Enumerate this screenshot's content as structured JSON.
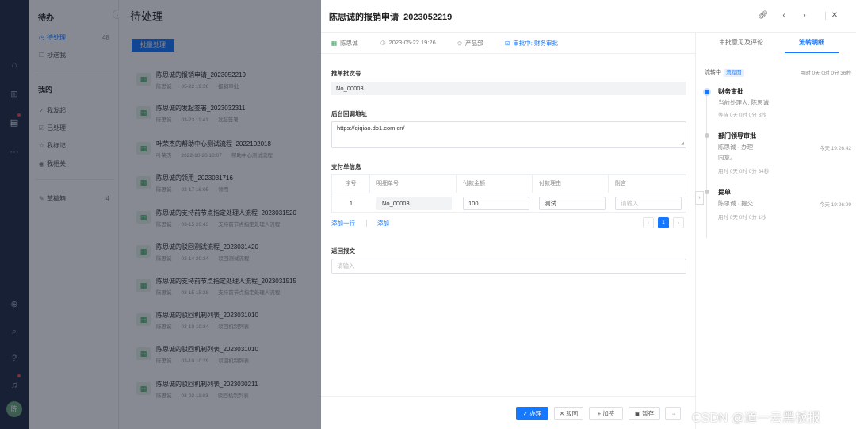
{
  "rail": {
    "icons": [
      "home-icon",
      "apps-icon",
      "doc-icon",
      "more-icon",
      "add-icon",
      "search-icon",
      "help-icon",
      "bell-icon"
    ],
    "avatar": "陈"
  },
  "sidebar": {
    "header": "待办",
    "todo": [
      {
        "label": "待处理",
        "count": "48"
      },
      {
        "label": "抄送我",
        "count": ""
      }
    ],
    "mine_header": "我的",
    "mine": [
      {
        "label": "我发起"
      },
      {
        "label": "已处理"
      },
      {
        "label": "我标记"
      },
      {
        "label": "我相关"
      }
    ],
    "drafts": {
      "label": "草稿箱",
      "count": "4"
    }
  },
  "list": {
    "title": "待处理",
    "batch_label": "批量处理",
    "items": [
      {
        "name": "陈思诚的报销申请_2023052219",
        "user": "陈思诚",
        "time": "05-22 19:26",
        "node": "报销审批"
      },
      {
        "name": "陈思诚的发起签署_2023032311",
        "user": "陈思诚",
        "time": "03-23 11:41",
        "node": "发起签署"
      },
      {
        "name": "叶荣杰的帮助中心测试流程_2022102018",
        "user": "叶荣杰",
        "time": "2022-10-20 18:07",
        "node": "帮助中心测试流程"
      },
      {
        "name": "陈思诚的领用_2023031716",
        "user": "陈思诚",
        "time": "03-17 16:05",
        "node": "领用"
      },
      {
        "name": "陈思诚的支持前节点指定处理人流程_2023031520",
        "user": "陈思诚",
        "time": "03-15 20:43",
        "node": "支持前节点指定处理人流程"
      },
      {
        "name": "陈思诚的驳回测试流程_2023031420",
        "user": "陈思诚",
        "time": "03-14 20:24",
        "node": "驳回测试流程"
      },
      {
        "name": "陈思诚的支持前节点指定处理人流程_2023031515",
        "user": "陈思诚",
        "time": "03-15 15:28",
        "node": "支持前节点指定处理人流程"
      },
      {
        "name": "陈思诚的驳回机制列表_2023031010",
        "user": "陈思诚",
        "time": "03-10 10:34",
        "node": "驳回机制列表"
      },
      {
        "name": "陈思诚的驳回机制列表_2023031010",
        "user": "陈思诚",
        "time": "03-10 10:29",
        "node": "驳回机制列表"
      },
      {
        "name": "陈思诚的驳回机制列表_2023030211",
        "user": "陈思诚",
        "time": "03-02 11:03",
        "node": "驳回机制列表"
      }
    ]
  },
  "panel": {
    "title": "陈思诚的报销申请_2023052219",
    "meta": {
      "user": "陈思诚",
      "time": "2023-05-22 19:26",
      "dept": "产品部",
      "status": "审批中: 财务审批"
    },
    "fields": {
      "batch_no_label": "推单批次号",
      "batch_no_value": "No_00003",
      "callback_label": "后台回调地址",
      "callback_value": "https://qiqiao.do1.com.cn/",
      "payment_label": "支付单信息",
      "return_label": "返回报文",
      "return_placeholder": "请输入"
    },
    "table": {
      "headers": [
        "序号",
        "明细单号",
        "付款金额",
        "付款理由",
        "附言"
      ],
      "row": {
        "index": "1",
        "detail_no": "No_00003",
        "amount": "100",
        "reason": "测试",
        "note_placeholder": "请输入"
      }
    },
    "add_row": "添加一行",
    "add": "添加",
    "page": "1",
    "buttons": {
      "handle": "办理",
      "reject": "驳回",
      "add_sign": "加签",
      "save": "暂存",
      "more": "···"
    },
    "tabs": [
      "审批意见及评论",
      "流转明细"
    ],
    "flow": {
      "state": "流转中",
      "badge": "流程图",
      "total": "用时 0天 0时 0分 36秒",
      "steps": [
        {
          "name": "财务审批",
          "line": "当前处理人: 陈思诚",
          "time": "",
          "extra": "",
          "wait": "等待 0天 0时 0分 3秒"
        },
        {
          "name": "部门领导审批",
          "line": "陈思诚 · 办理",
          "time": "今天 19:26:42",
          "extra": "同意。",
          "wait": "用时 0天 0时 0分 34秒"
        },
        {
          "name": "提单",
          "line": "陈思诚 · 提交",
          "time": "今天 19:26:09",
          "extra": "",
          "wait": "用时 0天 0时 0分 1秒"
        }
      ]
    }
  },
  "watermark": "CSDN @道一云黑板报"
}
